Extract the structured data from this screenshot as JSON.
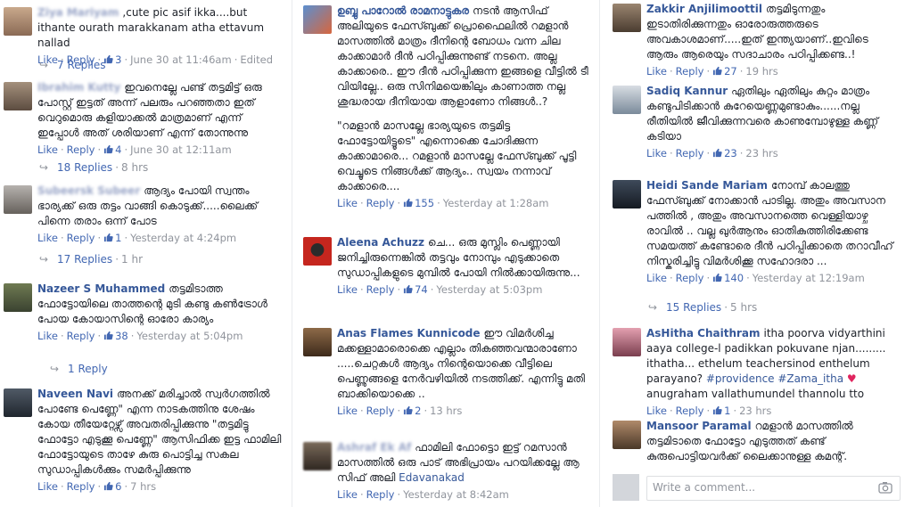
{
  "thread": {
    "like_label": "Like",
    "reply_label": "Reply",
    "write_placeholder": "Write a comment...",
    "edited_label": "Edited"
  },
  "col1": {
    "c1": {
      "name": "Ziya Mariyam",
      "text": ",cute pic asif ikka....but ithante ourath marakkanam atha ettavum nallad",
      "likes": "3",
      "time": "June 30 at 11:46am",
      "replies": "7 Replies"
    },
    "c2": {
      "name": "Ibrahim Kutty",
      "text": "ഇവനെല്ലേ പണ്ട് തട്ടമിട്ട് ഒരു പോസ്റ്റ് ഇട്ടത് അന്ന് പലരും പറഞ്ഞതാ ഇത് വെറുമൊരു കളിയാക്കൽ മാത്രമാണ് എന്ന് ഇപ്പോൾ അത് ശരിയാണ് എന്ന് തോന്നുന്നു",
      "likes": "4",
      "time": "June 30 at 12:11am",
      "replies": "18 Replies",
      "replies_time": "8 hrs"
    },
    "c3": {
      "name": "Subeersk Subeer",
      "text": "ആദ്യം പോയി സ്വന്തം ഭാര്യക്ക് ഒരു തട്ടം വാങ്ങി കൊടുക്ക്.....ലൈക്ക് പിന്നെ തരാം ഒന്ന് പോട",
      "likes": "1",
      "time": "Yesterday at 4:24pm",
      "replies": "17 Replies",
      "replies_time": "1 hr"
    },
    "c4": {
      "name": "Nazeer S Muhammed",
      "text": "തട്ടമിടാത്ത ഫോട്ടോയിലെ താത്തന്റെ മുടി കണ്ടു കൺട്രോൾ പോയ കോയാസിന്റെ ഓരോ കാര്യം",
      "likes": "38",
      "time": "Yesterday at 5:04pm",
      "replies": "1 Reply"
    },
    "c5": {
      "name": "Naveen Navi",
      "text": "അനക്ക് മരിച്ചാൽ സ്വർഗത്തിൽ പോണ്ടേ പെണ്ണേ\" എന്ന നാടകത്തിനു ശേഷം കോയ തീയേറ്റേഴ്സ് അവതരിപ്പിക്കുന്നു \"തട്ടമിട്ടു ഫോട്ടോ എടുക്കൂ പെണ്ണേ\" ആസിഫിക്ക ഇട്ട ഫാമിലി ഫോട്ടോയുടെ താഴേ കുരു പൊട്ടിച്ച സകല സുഡാപ്പികൾക്കും സമർപ്പിക്കുന്നു",
      "likes": "6",
      "time": "7 hrs"
    }
  },
  "col2": {
    "c1": {
      "name": "ഉബ്ബു പാറോൽ രാമനാട്ടുകര",
      "text": "നടൻ ആസിഫ് അലിയുടെ ഫേസ്ബുക്ക് പ്രൊഫൈലിൽ റമളാൻ മാസത്തിൽ മാത്രം ദീനിന്റെ ബോധം വന്ന ചില കാക്കാമാർ ദീൻ പഠിപ്പിക്കുന്നുണ്ട് നടനെ. അല്ല കാക്കാരെ.. ഈ ദീൻ പഠിപ്പിക്കുന്ന ഇങ്ങളെ വീട്ടിൽ ടീ വിയില്ലേ.. ഒരു സിനിമയെങ്കിലും കാണാത്ത നല്ല ശുദ്ധരായ ദീനിയായ ആളാണോ നിങ്ങൾ..?",
      "text2": "\"റമളാൻ മാസല്ലേ ഭാര്യയുടെ തട്ടമിട്ട ഫോട്ടോയിട്ടൂടെ\" എന്നൊക്കെ ചോദിക്കുന്ന കാക്കാമാരെ... റമളാൻ മാസല്ലേ ഫേസ്ബുക്ക് പൂട്ടി വെച്ചൂടെ നിങ്ങൾക്ക് ആദ്യം.. സ്വയം നന്നാവ് കാക്കാരെ....",
      "likes": "155",
      "time": "Yesterday at 1:28am"
    },
    "c2": {
      "name": "Aleena Achuzz",
      "text": "ചെ... ഒരു മുസ്ലിം പെണ്ണായി ജനിച്ചിരുന്നെങ്കിൽ തട്ടവും നോമ്പും എടുക്കാതെ സുഡാപ്പികളുടെ മുമ്പിൽ പോയി നിൽക്കായിരുന്നു...",
      "likes": "74",
      "time": "Yesterday at 5:03pm"
    },
    "c3": {
      "name": "Anas Flames Kunnicode",
      "text": "ഈ വിമർശിച്ച മക്കള്ളാമാരൊക്കെ എല്ലാം തികഞ്ഞവന്മാരാണോ .....ചെറ്റകൾ ആദ്യം നിന്റെയൊക്കെ വീട്ടിലെ പെണ്ണുങ്ങളെ നേർവഴിയിൽ നടത്തിക്ക്. എന്നിട്ടു മതി ബാക്കിയൊക്കെ ..",
      "likes": "2",
      "time": "13 hrs"
    },
    "c4": {
      "name": "Ashraf Ek Af",
      "text": "ഫാമിലി ഫോട്ടൊ ഇട്ട് റമസാൻ മാസത്തിൽ ഒരു പാട് അഭിപ്രായം പറയിക്കല്ലേ ആ സിഫ് അലി",
      "text_tail": "Edavanakad",
      "time": "Yesterday at 8:42am"
    }
  },
  "col3": {
    "c1": {
      "name": "Zakkir Anjilimoottil",
      "text": "തട്ടമിടുന്നതും ഇടാതിരിക്കുന്നതും ഓരോരുത്തരുടെ അവകാശമാണ്.....ഇത് ഇന്ത്യയാണ്..ഇവിടെ ആരും ആരെയും സദാചാരം പഠിപ്പിക്കണ്ട..!",
      "likes": "27",
      "time": "19 hrs"
    },
    "c2": {
      "name": "Sadiq Kannur",
      "text": "ഏതിലും ഏതിലും കുറ്റം മാത്രം കണ്ടുപിടിക്കാൻ കുറേയെണ്ണമുണ്ടാകും......നല്ല രീതിയിൽ ജീവിക്കുന്നവരെ കാണുമ്പോഴുള്ള കണ്ണ് കടിയാ",
      "likes": "23",
      "time": "23 hrs"
    },
    "c3": {
      "name": "Heidi Sande Mariam",
      "text": "നോമ്പ് കാലത്തു ഫേസ്ബുക്ക് നോക്കാൻ പാടില്ല. അതും അവസാന പത്തിൽ , അതും അവസാനത്തെ വെള്ളിയാഴ്ച രാവിൽ .. വല്ല ഖുർആനും ഓതികുത്തിരിക്കേണ്ട സമയത്ത് കണ്ടോരെ ദീൻ പഠിപ്പിക്കാതെ തറാവീഹ് നിസ്കരിച്ചിട്ടു വിമർശിക്കൂ സഹോദരാ ...",
      "likes": "140",
      "time": "Yesterday at 12:19am",
      "replies": "15 Replies",
      "replies_time": "5 hrs"
    },
    "c4": {
      "name": "AsHitha Chaithram",
      "text": "itha poorva vidyarthini aaya college-l padikkan pokuvane njan......... ithatha... ethelum teachersinod enthelum parayano?",
      "tags": "#providence #Zama_itha",
      "text_tail": "anugraham vallathumundel thannolu tto",
      "likes": "1",
      "time": "23 hrs"
    },
    "c5": {
      "name": "Mansoor Paramal",
      "text": "റമളാൻ മാസത്തിൽ തട്ടമിടാതെ ഫോട്ടോ എടുത്തത് കണ്ട് കുരുപൊട്ടിയവർക്ക് ലൈക്കാനുള്ള കമന്റ്."
    }
  }
}
